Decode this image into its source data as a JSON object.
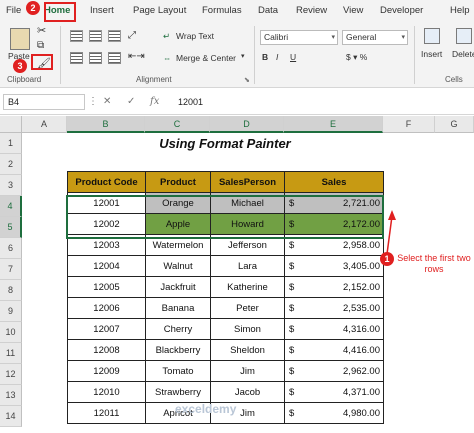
{
  "tabs": [
    "File",
    "Home",
    "Insert",
    "Page Layout",
    "Formulas",
    "Data",
    "Review",
    "View",
    "Developer",
    "Help"
  ],
  "ribbon": {
    "paste_label": "Paste",
    "clipboard_label": "Clipboard",
    "alignment_label": "Alignment",
    "wrap_text_label": "Wrap Text",
    "merge_center_label": "Merge & Center",
    "font_name": "Calibri",
    "number_format": "General",
    "insert_label": "Insert",
    "delete_label": "Delete",
    "cells_label": "Cells"
  },
  "formula_bar": {
    "name_box": "B4",
    "value": "12001"
  },
  "columns": [
    "A",
    "B",
    "C",
    "D",
    "E",
    "F",
    "G"
  ],
  "rows": [
    "1",
    "2",
    "3",
    "4",
    "5",
    "6",
    "7",
    "8",
    "9",
    "10",
    "11",
    "12",
    "13",
    "14"
  ],
  "sheet_title": "Using Format Painter",
  "table": {
    "headers": [
      "Product Code",
      "Product",
      "SalesPerson",
      "Sales"
    ],
    "currency": "$",
    "rows": [
      [
        "12001",
        "Orange",
        "Michael",
        "2,721.00"
      ],
      [
        "12002",
        "Apple",
        "Howard",
        "2,172.00"
      ],
      [
        "12003",
        "Watermelon",
        "Jefferson",
        "2,958.00"
      ],
      [
        "12004",
        "Walnut",
        "Lara",
        "3,405.00"
      ],
      [
        "12005",
        "Jackfruit",
        "Katherine",
        "2,152.00"
      ],
      [
        "12006",
        "Banana",
        "Peter",
        "2,535.00"
      ],
      [
        "12007",
        "Cherry",
        "Simon",
        "4,316.00"
      ],
      [
        "12008",
        "Blackberry",
        "Sheldon",
        "4,416.00"
      ],
      [
        "12009",
        "Tomato",
        "Jim",
        "2,962.00"
      ],
      [
        "12010",
        "Strawberry",
        "Jacob",
        "4,371.00"
      ],
      [
        "12011",
        "Apricot",
        "Jim",
        "4,980.00"
      ]
    ]
  },
  "annotations": {
    "step1": "1",
    "step2": "2",
    "step3": "3",
    "note": "Select the first two rows"
  },
  "watermark": "exceldemy",
  "colors": {
    "header_fill": "#c79a13",
    "gray_row": "#bfbfbf",
    "green_row": "#71a044",
    "annotation_red": "#e02020",
    "excel_green": "#1e6e3e"
  }
}
